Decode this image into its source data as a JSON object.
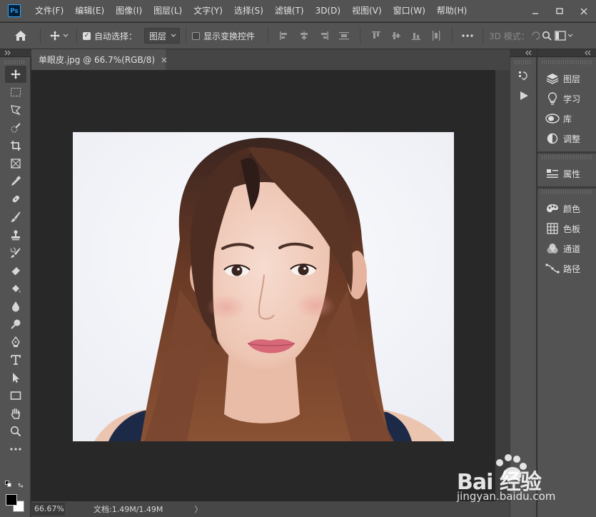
{
  "app": {
    "logo_text": "Ps"
  },
  "menubar": {
    "items": [
      "文件(F)",
      "编辑(E)",
      "图像(I)",
      "图层(L)",
      "文字(Y)",
      "选择(S)",
      "滤镜(T)",
      "3D(D)",
      "视图(V)",
      "窗口(W)",
      "帮助(H)"
    ]
  },
  "options_bar": {
    "auto_select_label": "自动选择：",
    "auto_select_checked": true,
    "auto_select_target": "图层",
    "show_transform_label": "显示变换控件",
    "show_transform_checked": false,
    "mode_3d_label": "3D 模式："
  },
  "document": {
    "tab_title": "单眼皮.jpg @ 66.7%(RGB/8)",
    "close_glyph": "×"
  },
  "status": {
    "zoom": "66.67%",
    "doc_info": "文档:1.49M/1.49M",
    "arrow": "〉"
  },
  "panels": {
    "group1": [
      {
        "label": "图层",
        "icon": "layers-icon"
      },
      {
        "label": "学习",
        "icon": "lightbulb-icon"
      },
      {
        "label": "库",
        "icon": "libraries-icon"
      },
      {
        "label": "调整",
        "icon": "adjustments-icon"
      }
    ],
    "group2": [
      {
        "label": "属性",
        "icon": "properties-icon"
      }
    ],
    "group3": [
      {
        "label": "颜色",
        "icon": "palette-icon"
      },
      {
        "label": "色板",
        "icon": "swatches-icon"
      },
      {
        "label": "通道",
        "icon": "channels-icon"
      },
      {
        "label": "路径",
        "icon": "paths-icon"
      }
    ]
  },
  "colors": {
    "foreground": "#000000",
    "background": "#ffffff"
  },
  "watermark": {
    "brand": "Bai 经验",
    "url": "jingyan.baidu.com"
  }
}
